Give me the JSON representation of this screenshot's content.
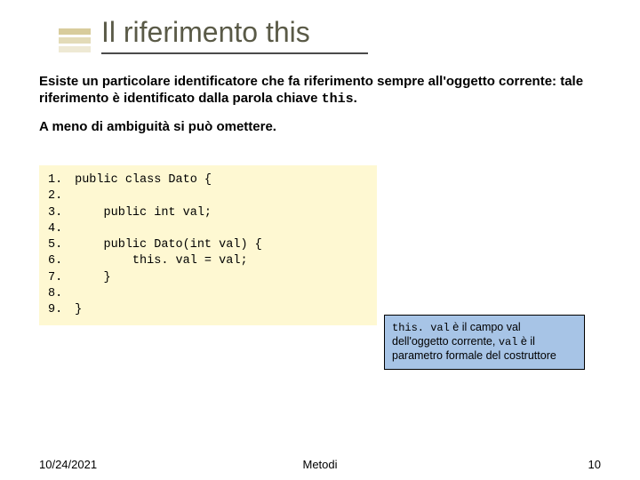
{
  "title": "Il riferimento this",
  "para1_a": "Esiste un particolare identificatore che fa riferimento sempre all'oggetto corrente: tale riferimento è identificato dalla parola chiave ",
  "para1_kw": "this",
  "para1_b": ".",
  "para2": "A meno di ambiguità si può omettere.",
  "code": {
    "l1": "public class Dato {",
    "l2": "",
    "l3": "    public int val;",
    "l4": "",
    "l5": "    public Dato(int val) {",
    "l6": "        this. val = val;",
    "l7": "    }",
    "l8": "",
    "l9": "}"
  },
  "ln": {
    "n1": "1.",
    "n2": "2.",
    "n3": "3.",
    "n4": "4.",
    "n5": "5.",
    "n6": "6.",
    "n7": "7.",
    "n8": "8.",
    "n9": "9."
  },
  "callout_a": "this. val",
  "callout_b": " è il campo val dell'oggetto corrente, ",
  "callout_c": "val",
  "callout_d": " è il parametro formale del costruttore",
  "footer": {
    "date": "10/24/2021",
    "center": "Metodi",
    "page": "10"
  }
}
